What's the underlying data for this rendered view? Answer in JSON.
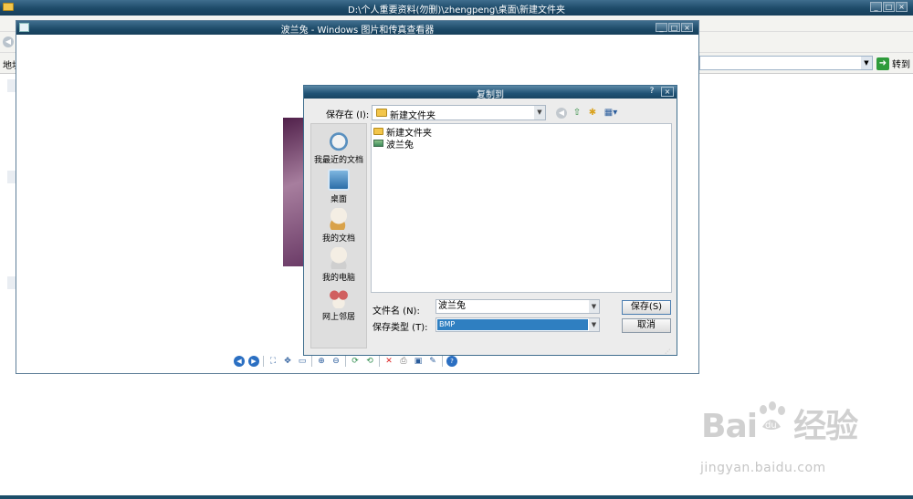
{
  "explorer": {
    "title": "D:\\个人重要资料(勿删)\\zhengpeng\\桌面\\新建文件夹",
    "address_label": "地址",
    "go_label": "转到",
    "win_buttons": [
      "_",
      "□",
      "×"
    ]
  },
  "viewer": {
    "title": "波兰兔 - Windows 图片和传真查看器",
    "win_buttons": [
      "_",
      "□",
      "×"
    ]
  },
  "dialog": {
    "title": "复制到",
    "help": "?",
    "close": "×",
    "save_in_label": "保存在 (I):",
    "save_in_value": "新建文件夹",
    "places": [
      {
        "label": "我最近的文档",
        "icon": "recent-documents-icon"
      },
      {
        "label": "桌面",
        "icon": "desktop-icon"
      },
      {
        "label": "我的文档",
        "icon": "my-documents-icon"
      },
      {
        "label": "我的电脑",
        "icon": "my-computer-icon"
      },
      {
        "label": "网上邻居",
        "icon": "network-places-icon"
      }
    ],
    "files": [
      {
        "name": "新建文件夹",
        "icon": "folder-icon"
      },
      {
        "name": "波兰兔",
        "icon": "image-file-icon"
      }
    ],
    "filename_label": "文件名 (N):",
    "filename_value": "波兰兔",
    "filetype_label": "保存类型 (T):",
    "filetype_value": "BMP",
    "save_button": "保存(S)",
    "cancel_button": "取消"
  },
  "watermark": {
    "logo_text_1": "Bai",
    "logo_text_2": "经验",
    "url": "jingyan.baidu.com"
  },
  "colors": {
    "titlebar": "#1d4a68",
    "selection": "#2f7fc1",
    "go_icon": "#2e9b3b"
  }
}
